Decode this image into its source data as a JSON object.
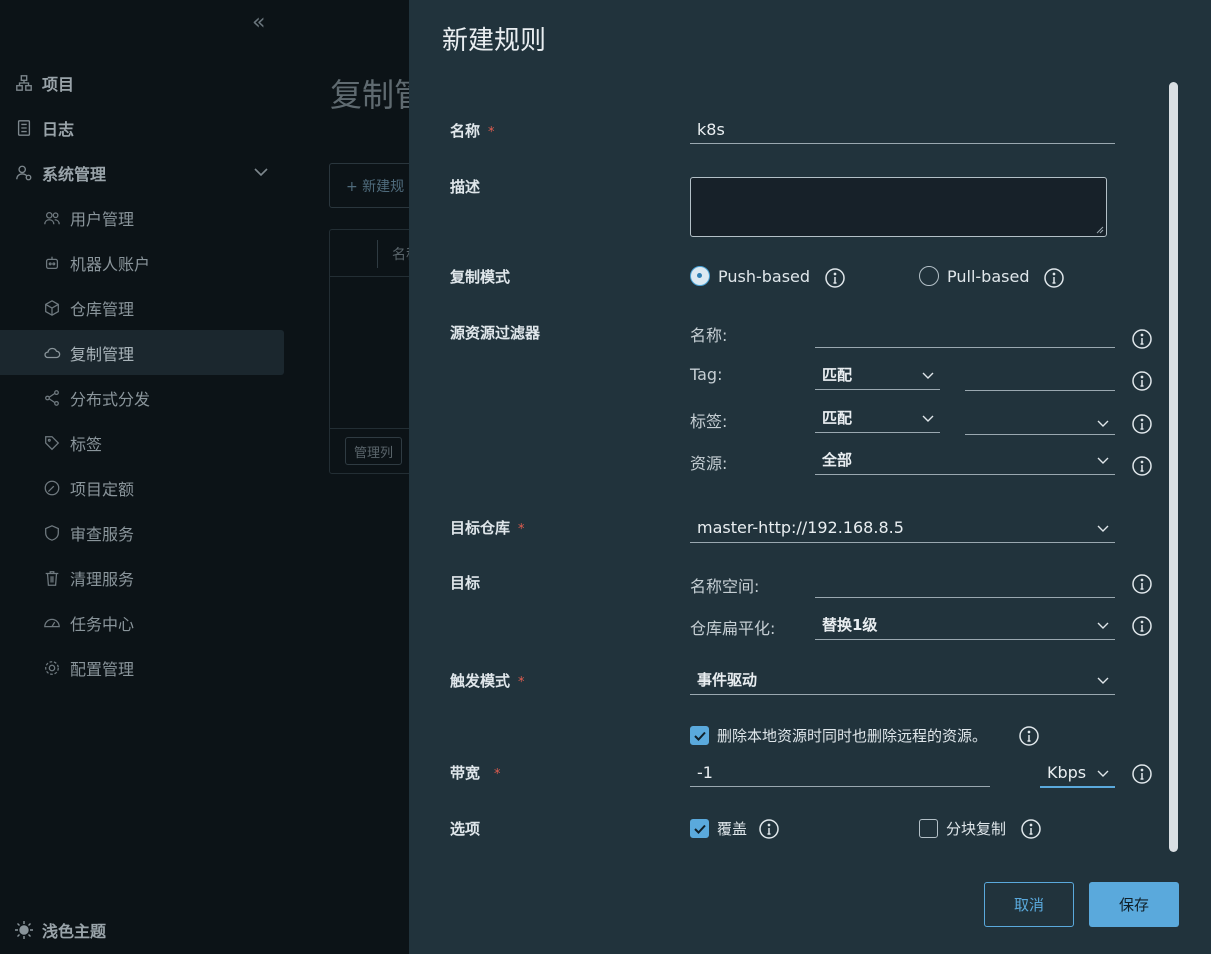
{
  "sidebar": {
    "collapse_icon": "double-chevron-left-icon",
    "items": [
      {
        "label": "项目",
        "icon": "project-icon",
        "level": "top"
      },
      {
        "label": "日志",
        "icon": "log-icon",
        "level": "top"
      },
      {
        "label": "系统管理",
        "icon": "user-settings-icon",
        "level": "top",
        "expanded": true
      },
      {
        "label": "用户管理",
        "icon": "users-icon",
        "level": "sub"
      },
      {
        "label": "机器人账户",
        "icon": "robot-icon",
        "level": "sub"
      },
      {
        "label": "仓库管理",
        "icon": "cube-icon",
        "level": "sub"
      },
      {
        "label": "复制管理",
        "icon": "cloud-icon",
        "level": "sub",
        "active": true
      },
      {
        "label": "分布式分发",
        "icon": "share-icon",
        "level": "sub"
      },
      {
        "label": "标签",
        "icon": "tag-icon",
        "level": "sub"
      },
      {
        "label": "项目定额",
        "icon": "gauge-icon",
        "level": "sub"
      },
      {
        "label": "审查服务",
        "icon": "shield-icon",
        "level": "sub"
      },
      {
        "label": "清理服务",
        "icon": "trash-icon",
        "level": "sub"
      },
      {
        "label": "任务中心",
        "icon": "dashboard-icon",
        "level": "sub"
      },
      {
        "label": "配置管理",
        "icon": "gear-icon",
        "level": "sub"
      }
    ],
    "theme_label": "浅色主题"
  },
  "background": {
    "page_title": "复制管",
    "new_button": "+ 新建规",
    "table_header": "名称",
    "manage_columns": "管理列"
  },
  "modal": {
    "title": "新建规则",
    "name": {
      "label": "名称",
      "required": "*",
      "value": "k8s"
    },
    "description": {
      "label": "描述",
      "value": ""
    },
    "replication_mode": {
      "label": "复制模式",
      "options": [
        {
          "label": "Push-based",
          "selected": true
        },
        {
          "label": "Pull-based",
          "selected": false
        }
      ]
    },
    "source_filter": {
      "label": "源资源过滤器",
      "name_label": "名称:",
      "name_value": "",
      "tag_label": "Tag:",
      "tag_match": "匹配",
      "tag_value": "",
      "label_label": "标签:",
      "label_match": "匹配",
      "label_value": "",
      "resource_label": "资源:",
      "resource_value": "全部"
    },
    "target_registry": {
      "label": "目标仓库",
      "required": "*",
      "value": "master-http://192.168.8.5"
    },
    "target": {
      "label": "目标",
      "namespace_label": "名称空间:",
      "namespace_value": "",
      "flatten_label": "仓库扁平化:",
      "flatten_value": "替换1级"
    },
    "trigger_mode": {
      "label": "触发模式",
      "required": "*",
      "value": "事件驱动"
    },
    "delete_remote": {
      "label": "删除本地资源时同时也删除远程的资源。",
      "checked": true
    },
    "bandwidth": {
      "label": "带宽",
      "required": "*",
      "value": "-1",
      "unit": "Kbps"
    },
    "options": {
      "label": "选项",
      "override": {
        "label": "覆盖",
        "checked": true
      },
      "chunked": {
        "label": "分块复制",
        "checked": false
      }
    },
    "cancel_label": "取消",
    "save_label": "保存",
    "colors": {
      "accent": "#5aa9dc",
      "modal_bg": "#21333c",
      "required": "#e05d4f"
    }
  }
}
